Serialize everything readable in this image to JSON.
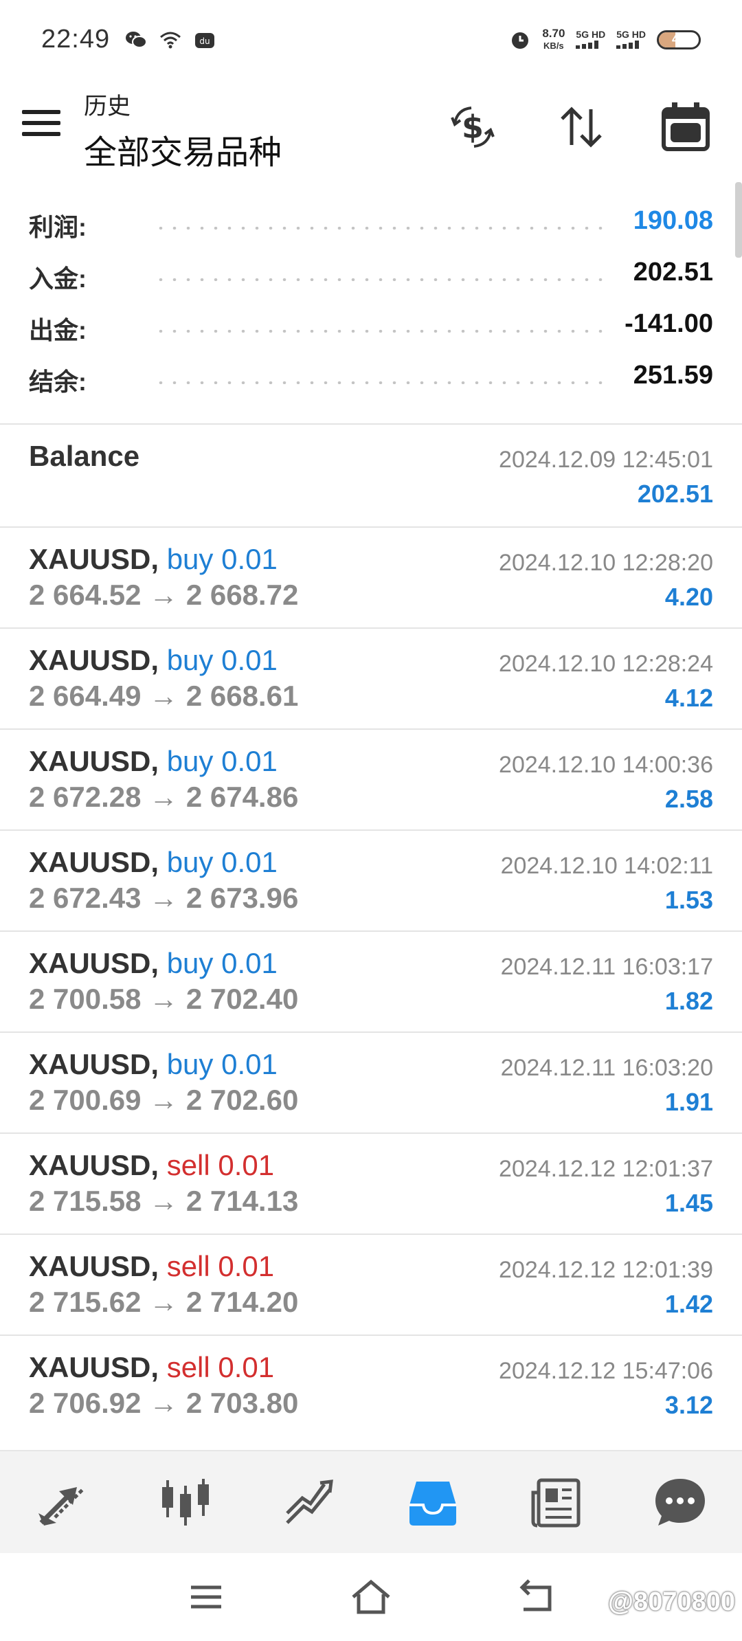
{
  "status_bar": {
    "time": "22:49",
    "speed_value": "8.70",
    "speed_unit": "KB/s",
    "net1": "5G HD",
    "net2": "5G HD",
    "battery": "42",
    "battery_level": 0.42
  },
  "header": {
    "section": "历史",
    "title": "全部交易品种",
    "icons": [
      "menu-icon",
      "dollar-cycle-icon",
      "sort-icon",
      "calendar-icon"
    ]
  },
  "summary": {
    "profit": {
      "label": "利润:",
      "value": "190.08"
    },
    "deposit": {
      "label": "入金:",
      "value": "202.51"
    },
    "withdrawal": {
      "label": "出金:",
      "value": "-141.00"
    },
    "balance": {
      "label": "结余:",
      "value": "251.59"
    }
  },
  "balance_entry": {
    "title": "Balance",
    "time": "2024.12.09 12:45:01",
    "amount": "202.51"
  },
  "deals": [
    {
      "symbol": "XAUUSD,",
      "side": "buy 0.01",
      "prices": "2 664.52 → 2 668.72",
      "time": "2024.12.10 12:28:20",
      "profit": "4.20"
    },
    {
      "symbol": "XAUUSD,",
      "side": "buy 0.01",
      "prices": "2 664.49 → 2 668.61",
      "time": "2024.12.10 12:28:24",
      "profit": "4.12"
    },
    {
      "symbol": "XAUUSD,",
      "side": "buy 0.01",
      "prices": "2 672.28 → 2 674.86",
      "time": "2024.12.10 14:00:36",
      "profit": "2.58"
    },
    {
      "symbol": "XAUUSD,",
      "side": "buy 0.01",
      "prices": "2 672.43 → 2 673.96",
      "time": "2024.12.10 14:02:11",
      "profit": "1.53"
    },
    {
      "symbol": "XAUUSD,",
      "side": "buy 0.01",
      "prices": "2 700.58 → 2 702.40",
      "time": "2024.12.11 16:03:17",
      "profit": "1.82"
    },
    {
      "symbol": "XAUUSD,",
      "side": "buy 0.01",
      "prices": "2 700.69 → 2 702.60",
      "time": "2024.12.11 16:03:20",
      "profit": "1.91"
    },
    {
      "symbol": "XAUUSD,",
      "side": "sell 0.01",
      "prices": "2 715.58 → 2 714.13",
      "time": "2024.12.12 12:01:37",
      "profit": "1.45"
    },
    {
      "symbol": "XAUUSD,",
      "side": "sell 0.01",
      "prices": "2 715.62 → 2 714.20",
      "time": "2024.12.12 12:01:39",
      "profit": "1.42"
    },
    {
      "symbol": "XAUUSD,",
      "side": "sell 0.01",
      "prices": "2 706.92 → 2 703.80",
      "time": "2024.12.12 15:47:06",
      "profit": "3.12"
    }
  ],
  "tabs": [
    {
      "icon": "quotes-icon",
      "active": false
    },
    {
      "icon": "chart-icon",
      "active": false
    },
    {
      "icon": "trade-icon",
      "active": false
    },
    {
      "icon": "history-icon",
      "active": true
    },
    {
      "icon": "news-icon",
      "active": false
    },
    {
      "icon": "chat-icon",
      "active": false
    }
  ],
  "watermark": "@8070800",
  "colors": {
    "buy": "#1e7fd4",
    "sell": "#d32f2f",
    "accent": "#2196f3"
  }
}
